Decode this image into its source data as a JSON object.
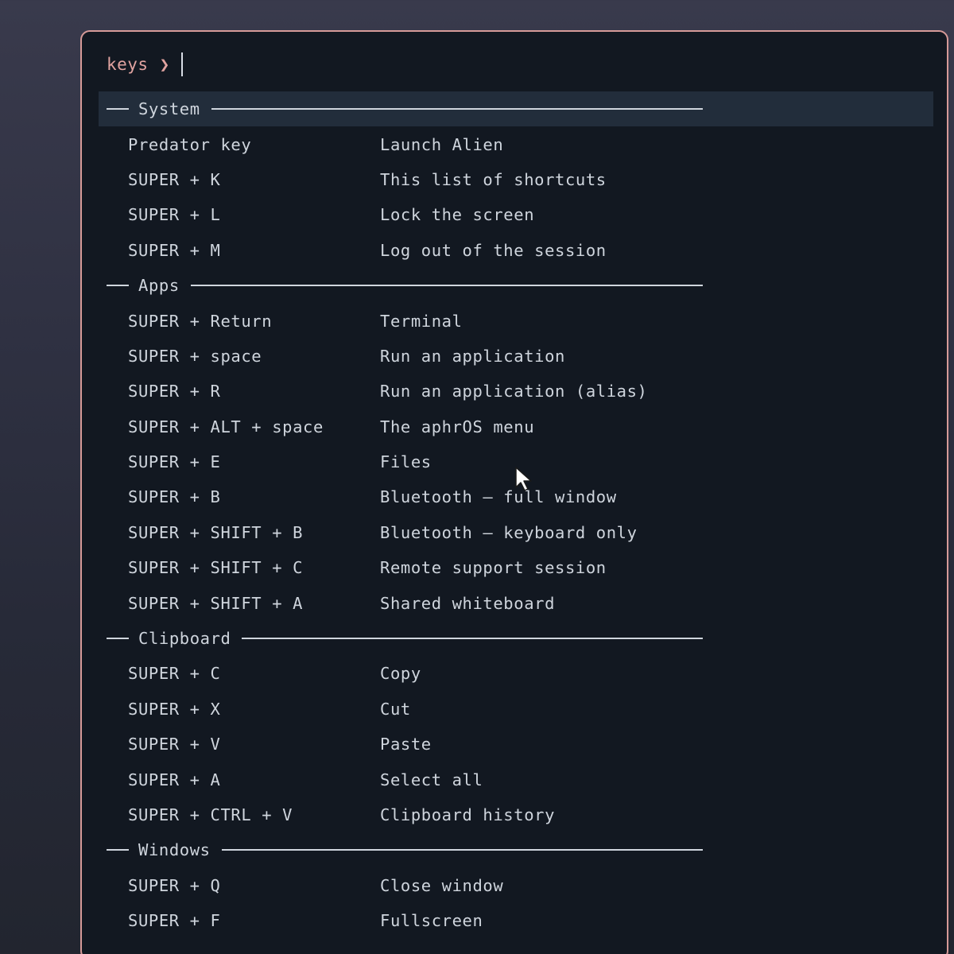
{
  "prompt": {
    "label": "keys",
    "chevron": "❯",
    "query": ""
  },
  "sections": [
    {
      "title": "System",
      "selected": true,
      "items": [
        {
          "key": "Predator key",
          "desc": "Launch Alien"
        },
        {
          "key": "SUPER + K",
          "desc": "This list of shortcuts"
        },
        {
          "key": "SUPER + L",
          "desc": "Lock the screen"
        },
        {
          "key": "SUPER + M",
          "desc": "Log out of the session"
        }
      ]
    },
    {
      "title": "Apps",
      "selected": false,
      "items": [
        {
          "key": "SUPER + Return",
          "desc": "Terminal"
        },
        {
          "key": "SUPER + space",
          "desc": "Run an application"
        },
        {
          "key": "SUPER + R",
          "desc": "Run an application (alias)"
        },
        {
          "key": "SUPER + ALT + space",
          "desc": "The aphrOS menu"
        },
        {
          "key": "SUPER + E",
          "desc": "Files"
        },
        {
          "key": "SUPER + B",
          "desc": "Bluetooth — full window"
        },
        {
          "key": "SUPER + SHIFT + B",
          "desc": "Bluetooth — keyboard only"
        },
        {
          "key": "SUPER + SHIFT + C",
          "desc": "Remote support session"
        },
        {
          "key": "SUPER + SHIFT + A",
          "desc": "Shared whiteboard"
        }
      ]
    },
    {
      "title": "Clipboard",
      "selected": false,
      "items": [
        {
          "key": "SUPER + C",
          "desc": "Copy"
        },
        {
          "key": "SUPER + X",
          "desc": "Cut"
        },
        {
          "key": "SUPER + V",
          "desc": "Paste"
        },
        {
          "key": "SUPER + A",
          "desc": "Select all"
        },
        {
          "key": "SUPER + CTRL + V",
          "desc": "Clipboard history"
        }
      ]
    },
    {
      "title": "Windows",
      "selected": false,
      "items": [
        {
          "key": "SUPER + Q",
          "desc": "Close window"
        },
        {
          "key": "SUPER + F",
          "desc": "Fullscreen"
        }
      ]
    }
  ],
  "colors": {
    "border_accent": "#d69a98",
    "prompt_text": "#e0a3a0",
    "panel_bg": "#121821",
    "selected_bg": "#222d3b",
    "text": "#cfd5dd"
  },
  "icons": {
    "pointer": "mouse-pointer-icon"
  }
}
